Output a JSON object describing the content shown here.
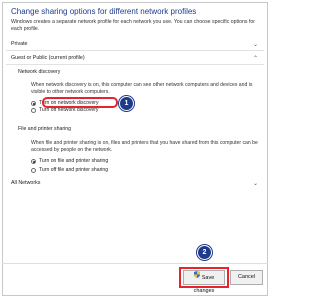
{
  "header": {
    "title": "Change sharing options for different network profiles",
    "intro": "Windows creates a separate network profile for each network you use. You can choose specific options for each profile."
  },
  "sections": {
    "private": {
      "label": "Private",
      "expanded": false
    },
    "guest_public": {
      "label": "Guest or Public (current profile)",
      "expanded": true
    },
    "all_networks": {
      "label": "All Networks",
      "expanded": false
    }
  },
  "network_discovery": {
    "title": "Network discovery",
    "description": "When network discovery is on, this computer can see other network computers and devices and is visible to other network computers.",
    "options": [
      {
        "label": "Turn on network discovery",
        "selected": true
      },
      {
        "label": "Turn off network discovery",
        "selected": false
      }
    ]
  },
  "file_printer_sharing": {
    "title": "File and printer sharing",
    "description": "When file and printer sharing is on, files and printers that you have shared from this computer can be accessed by people on the network.",
    "options": [
      {
        "label": "Turn on file and printer sharing",
        "selected": true
      },
      {
        "label": "Turn off file and printer sharing",
        "selected": false
      }
    ]
  },
  "footer": {
    "save_label": "Save changes",
    "cancel_label": "Cancel"
  },
  "annotations": {
    "step1": "1",
    "step2": "2",
    "highlight_color": "#e8232c",
    "badge_color": "#1f3a8a"
  }
}
